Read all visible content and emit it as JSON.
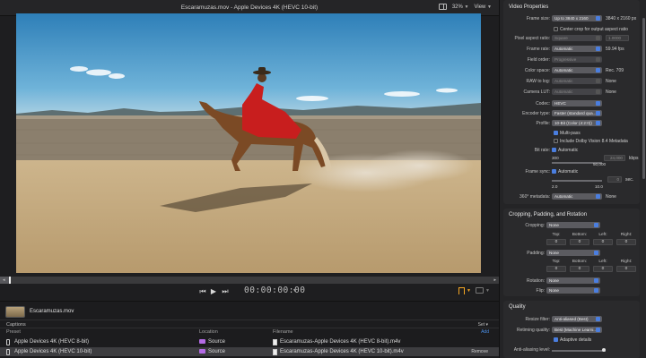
{
  "window": {
    "title": "Escaramuzas.mov - Apple Devices 4K (HEVC 10-bit)",
    "zoom": "32%",
    "view_label": "View"
  },
  "transport": {
    "timecode": "00:00:00:00",
    "playhead_fraction": 0.0
  },
  "file": {
    "name": "Escaramuzas.mov"
  },
  "captions": {
    "label": "Captions",
    "set_label": "Set",
    "add_label": "Add",
    "remove_label": "Remove",
    "columns": [
      "Preset",
      "Location",
      "Filename"
    ],
    "rows": [
      {
        "preset": "Apple Devices 4K (HEVC 8-bit)",
        "location": "Source",
        "filename": "Escaramuzas-Apple Devices 4K (HEVC 8-bit).m4v"
      },
      {
        "preset": "Apple Devices 4K (HEVC 10-bit)",
        "location": "Source",
        "filename": "Escaramuzas-Apple Devices 4K (HEVC 10-bit).m4v"
      }
    ]
  },
  "video_properties": {
    "title": "Video Properties",
    "frame_size": {
      "label": "Frame size:",
      "value": "Up to 3840 x 2160",
      "readout": "3840 x 2160 px"
    },
    "center_crop": "Center crop for output aspect ratio",
    "pixel_aspect": {
      "label": "Pixel aspect ratio:",
      "value": "Square",
      "readout": "1.0000"
    },
    "frame_rate": {
      "label": "Frame rate:",
      "value": "Automatic",
      "readout": "59.94 fps"
    },
    "field_order": {
      "label": "Field order:",
      "value": "Progressive"
    },
    "color_space": {
      "label": "Color space:",
      "value": "Automatic",
      "readout": "Rec. 709"
    },
    "raw_to_log": {
      "label": "RAW to log:",
      "value": "Automatic",
      "readout": "None"
    },
    "camera_lut": {
      "label": "Camera LUT:",
      "value": "Automatic",
      "readout": "None"
    },
    "codec": {
      "label": "Codec:",
      "value": "HEVC"
    },
    "encoder_type": {
      "label": "Encoder type:",
      "value": "Faster (standard qua..."
    },
    "profile": {
      "label": "Profile:",
      "value": "10-Bit (Color (4:2:0))"
    },
    "multi_pass": "Multi-pass",
    "dolby_vision": "Include Dolby Vision 8.4 Metadata",
    "bit_rate": {
      "label": "Bit rate:",
      "auto": "Automatic",
      "min": "300",
      "max": "50,000",
      "field": "24,000",
      "unit": "kbps"
    },
    "frame_sync": {
      "label": "Frame sync:",
      "auto": "Automatic",
      "field": "0",
      "unit": "sec.",
      "min": "2.0",
      "max": "10.0"
    },
    "metadata_360": {
      "label": "360° metadata:",
      "value": "Automatic",
      "readout": "None"
    }
  },
  "cropping": {
    "title": "Cropping, Padding, and Rotation",
    "cropping": {
      "label": "Cropping:",
      "value": "None"
    },
    "padding": {
      "label": "Padding:",
      "value": "None"
    },
    "edge_labels": [
      "Top:",
      "Bottom:",
      "Left:",
      "Right:"
    ],
    "crop_values": [
      "0",
      "0",
      "0",
      "0"
    ],
    "pad_values": [
      "0",
      "0",
      "0",
      "0"
    ],
    "rotation": {
      "label": "Rotation:",
      "value": "None"
    },
    "flip": {
      "label": "Flip:",
      "value": "None"
    }
  },
  "quality": {
    "title": "Quality",
    "resize_filter": {
      "label": "Resize filter:",
      "value": "Anti-aliased (Best)"
    },
    "retiming": {
      "label": "Retiming quality:",
      "value": "Best (Machine Learni..."
    },
    "adaptive": "Adaptive details",
    "anti_alias": {
      "label": "Anti-aliasing level:"
    }
  },
  "colors": {
    "accent": "#4a7ee0",
    "folder": "#b46be6",
    "marker": "#f5a623"
  }
}
